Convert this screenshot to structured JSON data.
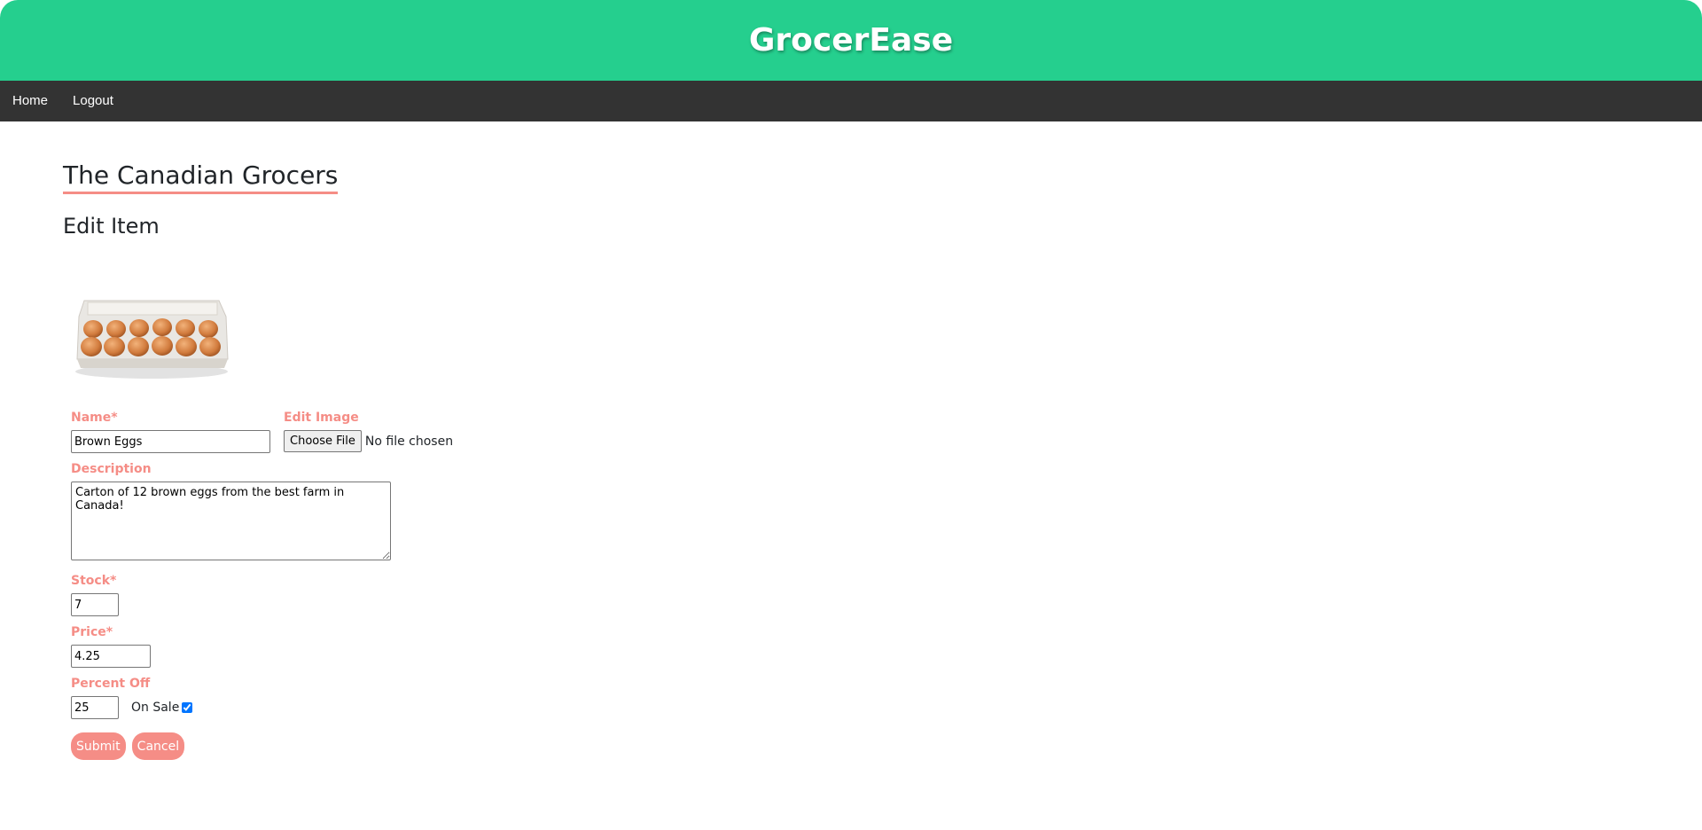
{
  "app": {
    "title": "GrocerEase"
  },
  "nav": {
    "home_label": "Home",
    "logout_label": "Logout"
  },
  "store": {
    "name": "The Canadian Grocers"
  },
  "page": {
    "heading": "Edit Item"
  },
  "item_image": {
    "icon": "egg-carton-image"
  },
  "form": {
    "name_label": "Name*",
    "name_value": "Brown Eggs",
    "image_label": "Edit Image",
    "choose_file_label": "Choose File",
    "file_status": "No file chosen",
    "description_label": "Description",
    "description_value": "Carton of 12 brown eggs from the best farm in Canada!",
    "stock_label": "Stock*",
    "stock_value": "7",
    "price_label": "Price*",
    "price_value": "4.25",
    "percent_off_label": "Percent Off",
    "percent_off_value": "25",
    "on_sale_label": "On Sale",
    "on_sale_checked": true,
    "submit_label": "Submit",
    "cancel_label": "Cancel"
  },
  "colors": {
    "header": "#25cf8e",
    "nav": "#333333",
    "accent": "#f58d86"
  }
}
